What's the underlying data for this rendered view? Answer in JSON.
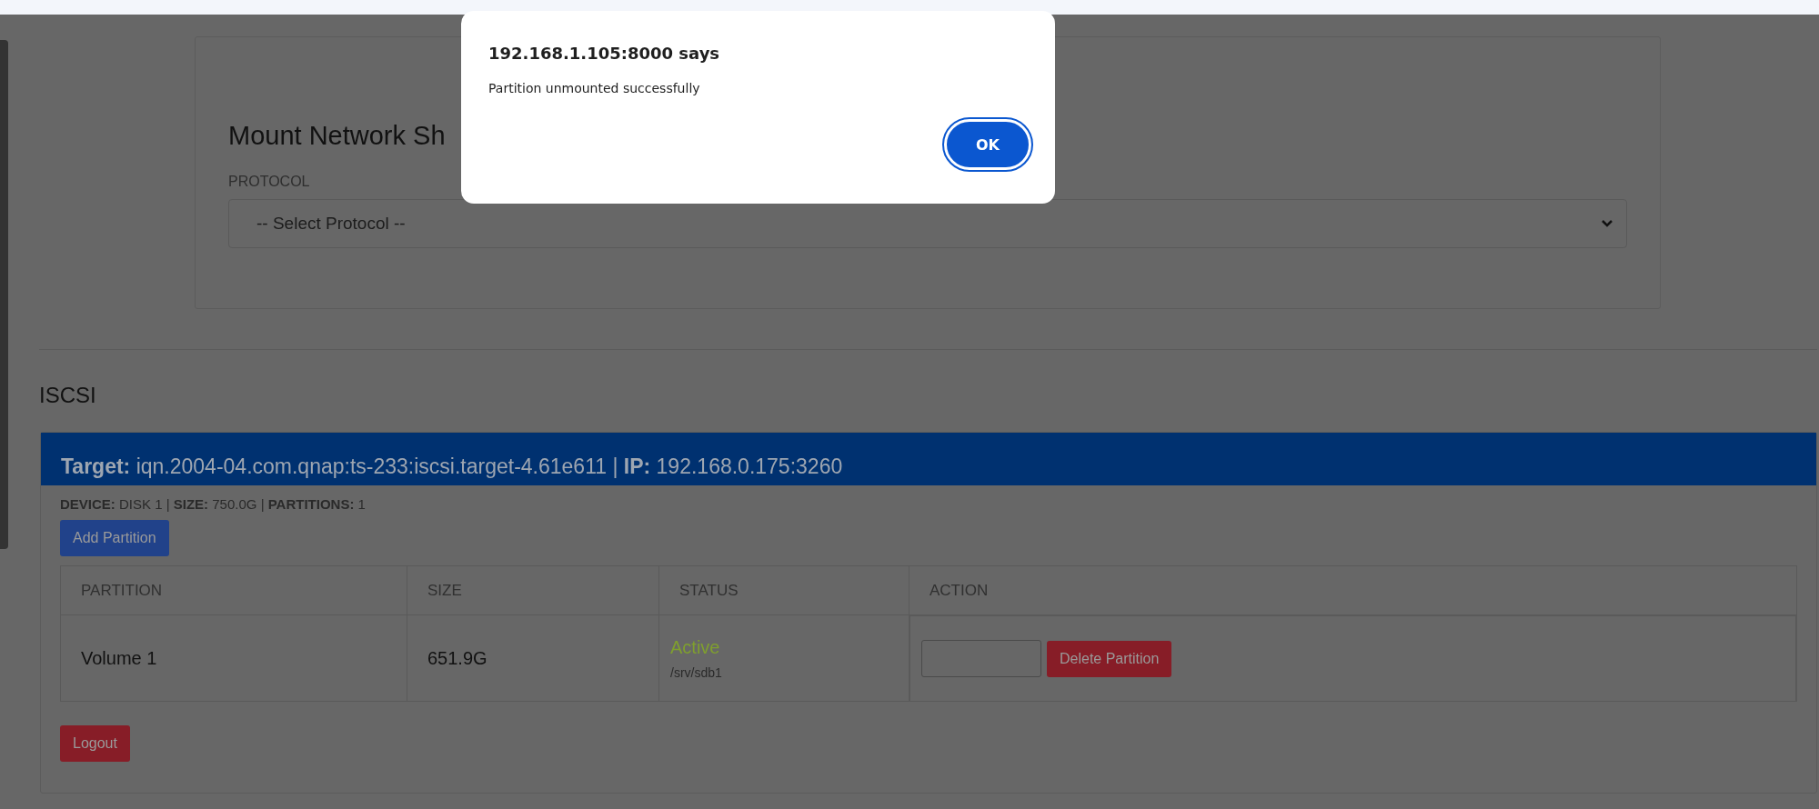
{
  "mount_card": {
    "title": "Mount Network Sh",
    "protocol_label": "PROTOCOL",
    "protocol_select": {
      "value": "-- Select Protocol --"
    }
  },
  "iscsi": {
    "heading": "ISCSI",
    "target": {
      "header": "**Target:** iqn.2004-04.com.qnap:ts-233:iscsi.target-4.61e611 | **IP:** 192.168.0.175:3260",
      "device_line": "**DEVICE:** DISK 1 | **SIZE:** 750.0G | **PARTITIONS:** 1",
      "add_button": "Add Partition",
      "table": {
        "columns": [
          "PARTITION",
          "SIZE",
          "STATUS",
          "ACTION"
        ],
        "rows": [
          {
            "partition": "Volume 1",
            "size": "651.9G",
            "status": {
              "label": "Active",
              "kind": "active",
              "path": "/srv/sdb1"
            },
            "action_button": "Delete Partition"
          }
        ]
      }
    }
  },
  "logout_button": "Logout",
  "alert": {
    "title": "192.168.1.105:8000 says",
    "message": "Partition unmounted successfully",
    "ok_button": "OK"
  }
}
